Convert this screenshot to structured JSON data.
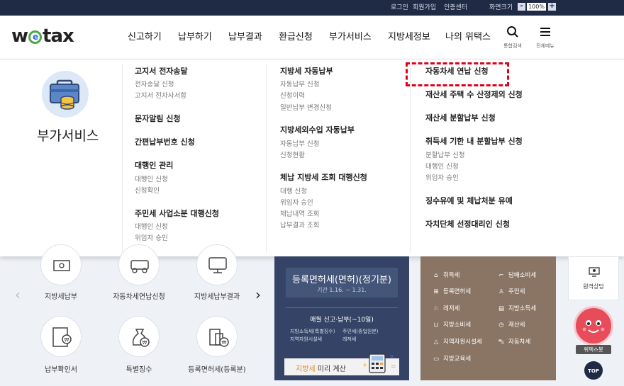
{
  "topbar": {
    "login": "로그인",
    "signup": "회원가입",
    "certcenter": "인증센터",
    "screensize": "화면크기",
    "zoom_minus": "-",
    "zoom": "100%",
    "zoom_plus": "+"
  },
  "header": {
    "logo": [
      "w",
      "e",
      "tax"
    ],
    "nav": [
      "신고하기",
      "납부하기",
      "납부결과",
      "환급신청",
      "부가서비스",
      "지방세정보",
      "나의 위택스"
    ],
    "search_label": "통합검색",
    "menu_label": "전체메뉴"
  },
  "mega": {
    "title": "부가서비스",
    "col1": {
      "h1": "고지서 전자송달",
      "h1_subs": [
        "전자송달 신청",
        "고지서 전자사서함"
      ],
      "h2": "문자알림 신청",
      "h3": "간편납부번호 신청",
      "h4": "대행인 관리",
      "h4_subs": [
        "대행인 신청",
        "신청확인"
      ],
      "h5": "주민세 사업소분 대행신청",
      "h5_subs": [
        "대행인 신청",
        "위임자 승인"
      ]
    },
    "col2": {
      "h1": "지방세 자동납부",
      "h1_subs": [
        "자동납부 신청",
        "신청이력",
        "일반납부 변경신청"
      ],
      "h2": "지방세외수입 자동납부",
      "h2_subs": [
        "자동납부 신청",
        "신청현황"
      ],
      "h3": "체납 지방세 조회 대행신청",
      "h3_subs": [
        "대행 신청",
        "위임자 승인",
        "체납내역 조회",
        "납부결과 조회"
      ]
    },
    "col3": {
      "h1": "자동차세 연납 신청",
      "h2": "재산세 주택 수 산정제외 신청",
      "h3": "재산세 분할납부 신청",
      "h4": "취득세 기한 내 분할납부 신청",
      "h4_subs": [
        "분할납부 신청",
        "대행인 신청",
        "위임자 승인"
      ],
      "h5": "징수유예 및 체납처분 유예",
      "h6": "자치단체 선정대리인 신청"
    }
  },
  "quick": {
    "items": [
      "지방세납부",
      "자동차세연납신청",
      "지방세납부결과",
      "납부확인서",
      "특별징수",
      "등록면허세(등록분)"
    ]
  },
  "banner": {
    "title": "등록면허세(면허)(정기분)",
    "period": "기간 1.16. ~ 1.31.",
    "monthly": "매월 신고·납부(~10일)",
    "items": [
      "지방소득세(특별징수)",
      "주민세(종업원분)",
      "지역자원시설세",
      "레저세"
    ],
    "calc_hl": "지방세",
    "calc_rest": " 미리 계산"
  },
  "taxes": {
    "left": [
      "취득세",
      "등록면허세",
      "레저세",
      "지방소비세",
      "지역자원시설세",
      "지방교육세"
    ],
    "right": [
      "담배소비세",
      "주민세",
      "지방소득세",
      "재산세",
      "자동차세"
    ]
  },
  "side": {
    "consult": "원격상담",
    "robot": "위택스봇",
    "top": "TOP"
  }
}
